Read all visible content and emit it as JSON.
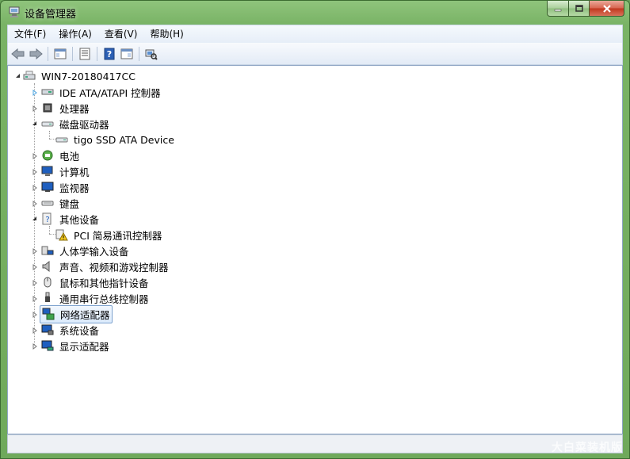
{
  "window": {
    "title": "设备管理器",
    "controls": {
      "minimize": "minimize",
      "maximize": "maximize",
      "close": "close"
    }
  },
  "menu": [
    {
      "label": "文件(F)"
    },
    {
      "label": "操作(A)"
    },
    {
      "label": "查看(V)"
    },
    {
      "label": "帮助(H)"
    }
  ],
  "toolbar": [
    "back-arrow-icon",
    "forward-arrow-icon",
    "show-hide-console-tree-icon",
    "properties-icon",
    "help-icon",
    "action-pane-icon",
    "scan-hardware-icon"
  ],
  "tree": {
    "root": {
      "label": "WIN7-20180417CC",
      "expanded": true,
      "icon": "computer-icon"
    },
    "items": [
      {
        "label": "IDE ATA/ATAPI 控制器",
        "icon": "ide-controller-icon",
        "expanded": false,
        "children": []
      },
      {
        "label": "处理器",
        "icon": "processor-icon",
        "expanded": false,
        "children": []
      },
      {
        "label": "磁盘驱动器",
        "icon": "disk-drive-icon",
        "expanded": true,
        "children": [
          {
            "label": "tigo SSD ATA Device",
            "icon": "disk-icon"
          }
        ]
      },
      {
        "label": "电池",
        "icon": "battery-icon",
        "expanded": false,
        "children": []
      },
      {
        "label": "计算机",
        "icon": "computer-icon",
        "expanded": false,
        "children": []
      },
      {
        "label": "监视器",
        "icon": "monitor-icon",
        "expanded": false,
        "children": []
      },
      {
        "label": "键盘",
        "icon": "keyboard-icon",
        "expanded": false,
        "children": []
      },
      {
        "label": "其他设备",
        "icon": "other-devices-icon",
        "expanded": true,
        "children": [
          {
            "label": "PCI 简易通讯控制器",
            "icon": "warning-device-icon"
          }
        ]
      },
      {
        "label": "人体学输入设备",
        "icon": "hid-icon",
        "expanded": false,
        "children": []
      },
      {
        "label": "声音、视频和游戏控制器",
        "icon": "speaker-icon",
        "expanded": false,
        "children": []
      },
      {
        "label": "鼠标和其他指针设备",
        "icon": "mouse-icon",
        "expanded": false,
        "children": []
      },
      {
        "label": "通用串行总线控制器",
        "icon": "usb-icon",
        "expanded": false,
        "children": []
      },
      {
        "label": "网络适配器",
        "icon": "network-adapter-icon",
        "expanded": false,
        "selected": true,
        "children": []
      },
      {
        "label": "系统设备",
        "icon": "system-device-icon",
        "expanded": false,
        "children": []
      },
      {
        "label": "显示适配器",
        "icon": "display-adapter-icon",
        "expanded": false,
        "children": []
      }
    ]
  },
  "colors": {
    "frame": "#79b365",
    "selection": "#dcebfc",
    "selection_border": "#7da2ce"
  },
  "watermark": "大白菜装机版"
}
